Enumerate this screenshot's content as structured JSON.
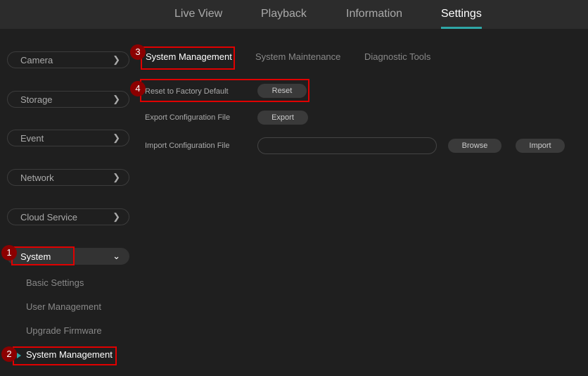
{
  "top_nav": [
    "Live View",
    "Playback",
    "Information",
    "Settings"
  ],
  "sidebar": {
    "items": [
      "Camera",
      "Storage",
      "Event",
      "Network",
      "Cloud Service"
    ],
    "system": "System",
    "sub_items": [
      "Basic Settings",
      "User Management",
      "Upgrade Firmware",
      "System Management"
    ]
  },
  "tabs": [
    "System Management",
    "System Maintenance",
    "Diagnostic Tools"
  ],
  "rows": {
    "reset_label": "Reset to Factory Default",
    "reset_btn": "Reset",
    "export_label": "Export Configuration File",
    "export_btn": "Export",
    "import_label": "Import Configuration File",
    "import_value": "",
    "browse_btn": "Browse",
    "import_btn": "Import"
  },
  "badges": [
    "1",
    "2",
    "3",
    "4"
  ],
  "colors": {
    "accent": "#2fa7a7",
    "highlight": "#e00000"
  }
}
